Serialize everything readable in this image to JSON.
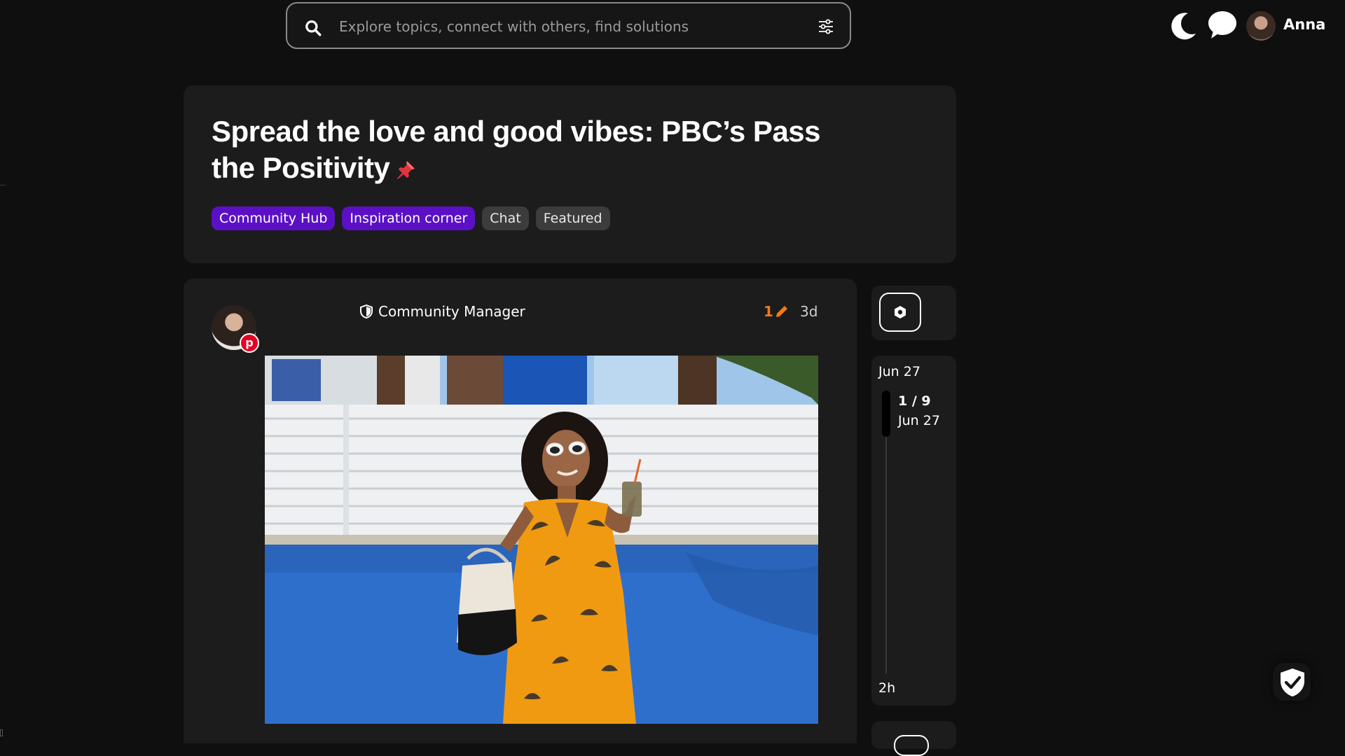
{
  "header": {
    "search_placeholder": "Explore topics, connect with others, find solutions",
    "username": "Anna",
    "icons": [
      "search-icon",
      "filter-icon",
      "moon-icon",
      "chat-icon"
    ]
  },
  "topic": {
    "title": "Spread the love and good vibes: PBC’s Pass the Positivity",
    "tags": [
      {
        "label": "Community Hub",
        "style": "purple"
      },
      {
        "label": "Inspiration corner",
        "style": "purple"
      },
      {
        "label": "Chat",
        "style": "gray"
      },
      {
        "label": "Featured",
        "style": "gray"
      }
    ]
  },
  "post": {
    "role": "Community Manager",
    "edit_count": "1",
    "age": "3d"
  },
  "timeline": {
    "start_date": "Jun 27",
    "position": "1 / 9",
    "current_date": "Jun 27",
    "end_label": "2h"
  },
  "colors": {
    "background": "#0f0f0f",
    "card": "#1c1c1c",
    "tag_purple": "#5b10c6",
    "tag_gray": "#3c3c3c",
    "edit_orange": "#f27b13",
    "pinterest_red": "#e60023"
  }
}
